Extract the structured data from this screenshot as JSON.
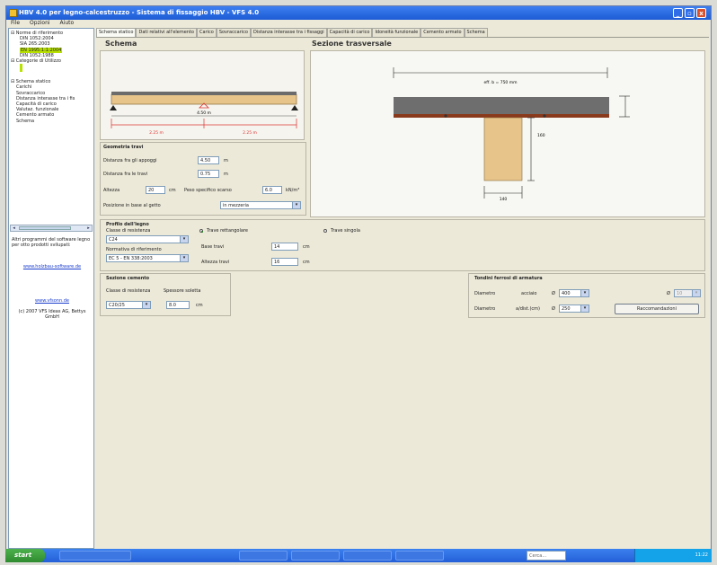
{
  "window": {
    "title": "HBV 4.0 per legno-calcestruzzo - Sistema di fissaggio HBV - VFS 4.0",
    "min_label": "_",
    "max_label": "▫",
    "close_label": "x"
  },
  "menu": [
    "File",
    "Opzioni",
    "Aiuto"
  ],
  "sidebar": {
    "tree": [
      "Norme di riferimento",
      "DIN 1052:2004",
      "SIA 265:2003",
      "EN 1995:1:1:2004",
      "DIN 1052:1988",
      "Categorie di Utilizzo",
      "Schema statico",
      "Carichi",
      "Sovraccarico",
      "Distanza interasse tra i fis",
      "Capacità di carico",
      "Valutaz. funzionale",
      "Cemento armato",
      "Schema"
    ],
    "selected_index": 3,
    "info_text": "Altri programmi del software legno per otto prodotti svilupati:",
    "link1": "www.holzbau-software.de",
    "link2": "www.vfsonn.de",
    "copyright": "(c) 2007 VFS Ideas AG, Bettys GmbH"
  },
  "tabs": [
    "Schema statico",
    "Dati relativi all'elemento",
    "Carico",
    "Sovraccarico",
    "Distanza interasse tra i fissaggi",
    "Capacità di carico",
    "Idoneità funzionale",
    "Cemento armato",
    "Schema"
  ],
  "active_tab": 0,
  "schema": {
    "heading": "Schema",
    "span_total": "4.50 m",
    "span_left": "2.25 m",
    "span_right": "2.25 m"
  },
  "sezione": {
    "heading": "Sezione trasversale",
    "width_label": "eff. b = 750 mm",
    "beam_height": "160",
    "beam_width": "140"
  },
  "geometria": {
    "title": "Geometria travi",
    "rows": [
      {
        "label": "Distanza fra gli appoggi",
        "value": "4.50",
        "unit": "m"
      },
      {
        "label": "Distanza fra le travi",
        "value": "0.75",
        "unit": "m"
      }
    ],
    "altezza_label": "Altezza",
    "altezza_value": "20",
    "altezza_unit": "cm",
    "peso_label": "Peso specifico scarso",
    "peso_value": "6.0",
    "peso_unit": "kN/m³",
    "posizione_label": "Posizione in base al getto",
    "posizione_value": "in mezzeria"
  },
  "profilo": {
    "title": "Profilo dell'legno",
    "classe_label": "Classe di resistenza",
    "classe_value": "C24",
    "normativa_label": "Normativa di riferimento",
    "normativa_value": "EC 5 - EN 338:2003",
    "radio1": "Trave rettangolare",
    "radio2": "Trave singola",
    "base_label": "Base travi",
    "base_value": "14",
    "base_unit": "cm",
    "altezza_label": "Altezza travi",
    "altezza_value": "16",
    "altezza_unit": "cm"
  },
  "sezione_cemento": {
    "title": "Sezione cemento",
    "classe_label": "Classe di resistenza",
    "classe_value": "C20/25",
    "spessore_label": "Spessore soletta",
    "spessore_value": "8.0",
    "spessore_unit": "cm"
  },
  "tondini": {
    "title": "Tondini ferrosi di armatura",
    "row1_label": "Diametro",
    "row1_mid": "acciaio",
    "row1_d": "Ø",
    "row1_value": "400",
    "row1_right": "Ø",
    "row1_right_value": "10",
    "row2_label": "Diametro",
    "row2_mid": "a/dist.(cm)",
    "row2_d": "Ø",
    "row2_value": "250",
    "button": "Raccomandazioni"
  },
  "taskbar": {
    "start": "start",
    "tasks": [
      "",
      "",
      "",
      "",
      ""
    ],
    "search_placeholder": "Cerca...",
    "clock": "11:22"
  }
}
